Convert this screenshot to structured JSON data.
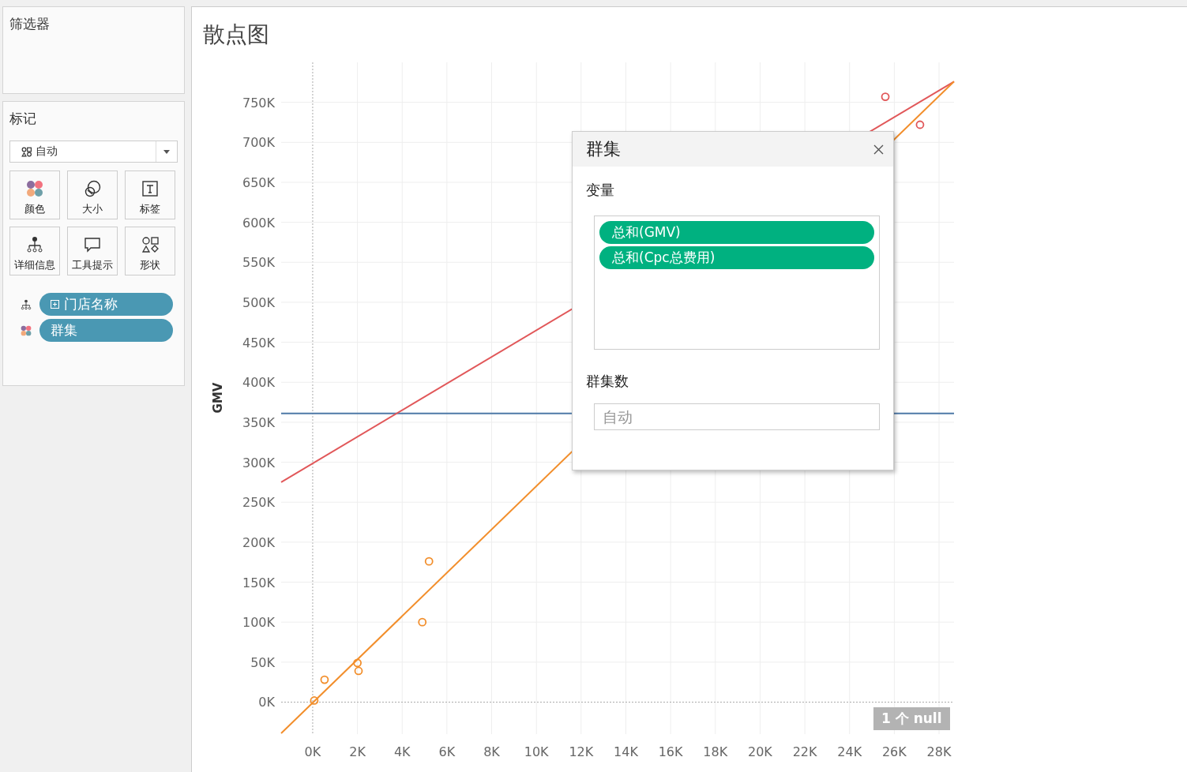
{
  "filters_panel": {
    "title": "筛选器"
  },
  "marks_panel": {
    "title": "标记",
    "mark_type": {
      "value": "自动"
    },
    "cards": [
      {
        "label": "颜色",
        "kind": "color"
      },
      {
        "label": "大小",
        "kind": "size"
      },
      {
        "label": "标签",
        "kind": "label"
      },
      {
        "label": "详细信息",
        "kind": "detail"
      },
      {
        "label": "工具提示",
        "kind": "tooltip"
      },
      {
        "label": "形状",
        "kind": "shape"
      }
    ],
    "pills": [
      {
        "label": "门店名称",
        "kind": "detail",
        "expandable": true
      },
      {
        "label": "群集",
        "kind": "color",
        "expandable": false
      }
    ]
  },
  "worksheet": {
    "title": "散点图",
    "null_badge": "1 个 null",
    "chart_data": {
      "type": "scatter",
      "ylabel": "GMV",
      "xlim": [
        -1410,
        28670
      ],
      "ylim": [
        -40000,
        800000
      ],
      "xticks": [
        {
          "value": 0,
          "label": "0K"
        },
        {
          "value": 2000,
          "label": "2K"
        },
        {
          "value": 4000,
          "label": "4K"
        },
        {
          "value": 6000,
          "label": "6K"
        },
        {
          "value": 8000,
          "label": "8K"
        },
        {
          "value": 10000,
          "label": "10K"
        },
        {
          "value": 12000,
          "label": "12K"
        },
        {
          "value": 14000,
          "label": "14K"
        },
        {
          "value": 16000,
          "label": "16K"
        },
        {
          "value": 18000,
          "label": "18K"
        },
        {
          "value": 20000,
          "label": "20K"
        },
        {
          "value": 22000,
          "label": "22K"
        },
        {
          "value": 24000,
          "label": "24K"
        },
        {
          "value": 26000,
          "label": "26K"
        },
        {
          "value": 28000,
          "label": "28K"
        }
      ],
      "yticks": [
        {
          "value": 0,
          "label": "0K"
        },
        {
          "value": 50000,
          "label": "50K"
        },
        {
          "value": 100000,
          "label": "100K"
        },
        {
          "value": 150000,
          "label": "150K"
        },
        {
          "value": 200000,
          "label": "200K"
        },
        {
          "value": 250000,
          "label": "250K"
        },
        {
          "value": 300000,
          "label": "300K"
        },
        {
          "value": 350000,
          "label": "350K"
        },
        {
          "value": 400000,
          "label": "400K"
        },
        {
          "value": 450000,
          "label": "450K"
        },
        {
          "value": 500000,
          "label": "500K"
        },
        {
          "value": 550000,
          "label": "550K"
        },
        {
          "value": 600000,
          "label": "600K"
        },
        {
          "value": 650000,
          "label": "650K"
        },
        {
          "value": 700000,
          "label": "700K"
        },
        {
          "value": 750000,
          "label": "750K"
        }
      ],
      "grid": true,
      "series": [
        {
          "type": "scatter",
          "color": "#f28e2b",
          "x": [
            70,
            530,
            2000,
            2050,
            4900,
            5200
          ],
          "values": [
            2000,
            28000,
            49000,
            39000,
            100000,
            176000
          ]
        },
        {
          "type": "scatter",
          "color": "#e15759",
          "x": [
            25600,
            27150
          ],
          "values": [
            757000,
            722000
          ]
        },
        {
          "type": "line",
          "color": "#e15759",
          "x": [
            -1410,
            28670
          ],
          "values": [
            275000,
            776000
          ]
        },
        {
          "type": "line",
          "color": "#f28e2b",
          "x": [
            -1410,
            28670
          ],
          "values": [
            -39000,
            776000
          ]
        }
      ],
      "ref_lines": [
        {
          "axis": "y",
          "value": 361000,
          "color": "#4e79a7"
        }
      ]
    }
  },
  "cluster_dialog": {
    "title": "群集",
    "variables_label": "变量",
    "variables": [
      "总和(GMV)",
      "总和(Cpc总费用)"
    ],
    "count_label": "群集数",
    "count_field": {
      "placeholder": "自动"
    }
  }
}
